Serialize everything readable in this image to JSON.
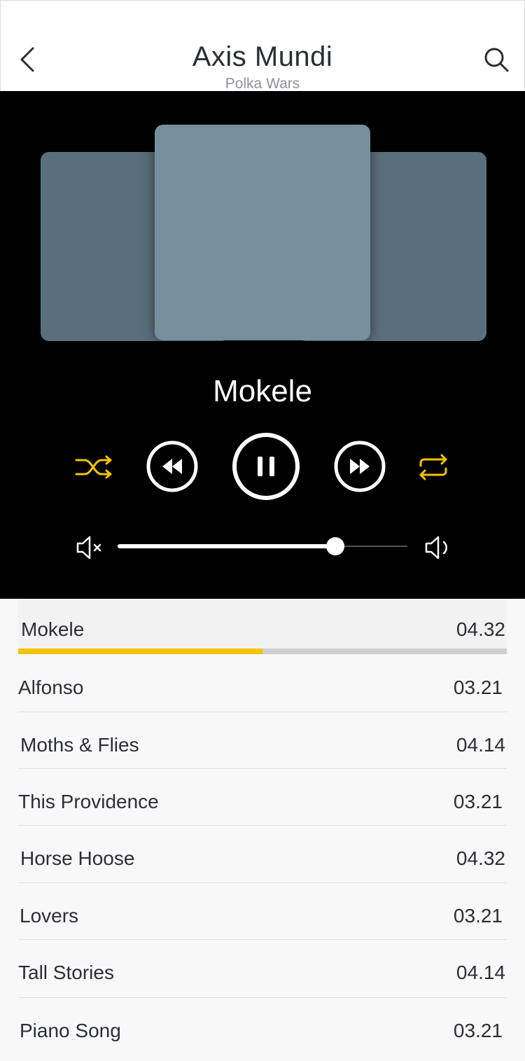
{
  "header": {
    "title": "Axis Mundi",
    "subtitle": "Polka Wars"
  },
  "player": {
    "now_playing": "Mokele",
    "volume_level": 0.75,
    "icons": {
      "back": "chevron-left-icon",
      "search": "search-icon",
      "shuffle": "shuffle-icon",
      "rewind": "rewind-icon",
      "pause": "pause-icon",
      "forward": "fast-forward-icon",
      "repeat": "repeat-icon",
      "mute": "mute-icon",
      "volume": "volume-icon"
    }
  },
  "tracklist": {
    "current": {
      "title": "Mokele",
      "duration": "04.32",
      "progress": 0.5
    },
    "items": [
      {
        "title": "Alfonso",
        "duration": "03.21"
      },
      {
        "title": "Moths & Flies",
        "duration": "04.14"
      },
      {
        "title": "This Providence",
        "duration": "03.21"
      },
      {
        "title": "Horse Hoose",
        "duration": "04.32"
      },
      {
        "title": "Lovers",
        "duration": "03.21"
      },
      {
        "title": "Tall Stories",
        "duration": "04.14"
      },
      {
        "title": "Piano Song",
        "duration": "03.21"
      }
    ]
  },
  "colors": {
    "accent": "#f5c300",
    "player_background": "#000000",
    "art_center": "#768f9c",
    "art_side": "#5a6f7c",
    "list_background": "#f8f8f8"
  }
}
